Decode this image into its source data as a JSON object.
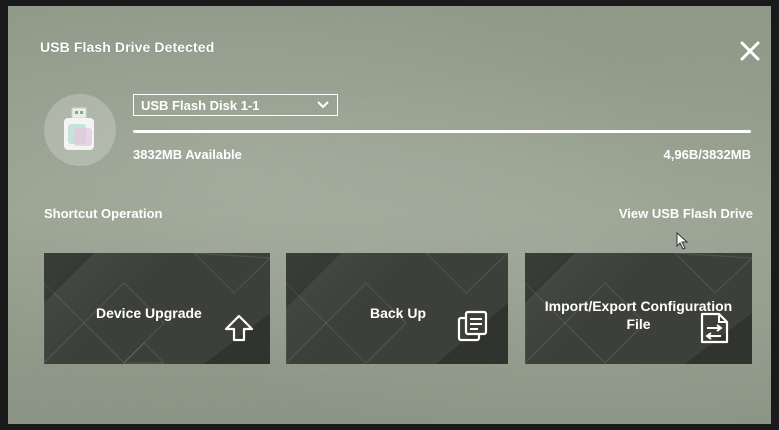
{
  "dialog": {
    "title": "USB Flash Drive Detected",
    "close_icon": "close-icon"
  },
  "drive": {
    "icon": "usb-drive-icon",
    "selected": "USB Flash Disk 1-1",
    "available": "3832MB Available",
    "usage": "4,96B/3832MB"
  },
  "shortcuts": {
    "heading": "Shortcut Operation",
    "view_link": "View USB Flash Drive",
    "tiles": [
      {
        "label": "Device Upgrade",
        "icon": "upload-arrow-icon"
      },
      {
        "label": "Back Up",
        "icon": "backup-copy-icon"
      },
      {
        "label": "Import/Export Configuration File",
        "icon": "import-export-file-icon"
      }
    ]
  },
  "colors": {
    "text": "#ffffff",
    "tile_bg": "#3c3f3a",
    "overlay": "#8e9a88"
  }
}
